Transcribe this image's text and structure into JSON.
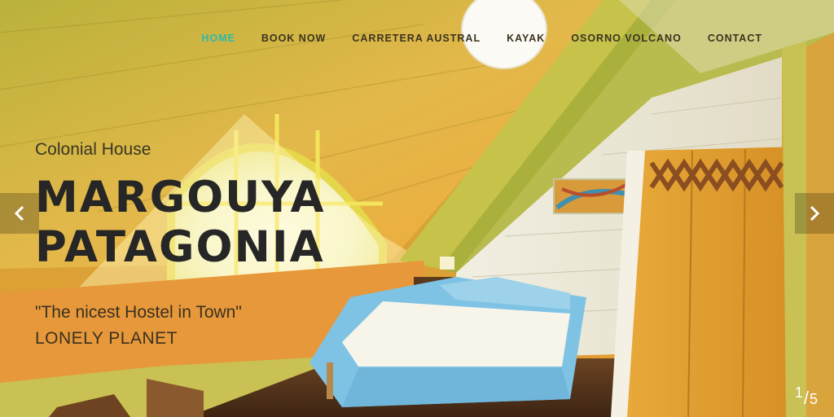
{
  "nav": {
    "items": [
      {
        "label": "HOME",
        "active": true
      },
      {
        "label": "BOOK NOW",
        "active": false
      },
      {
        "label": "CARRETERA AUSTRAL",
        "active": false
      },
      {
        "label": "KAYAK",
        "active": false
      },
      {
        "label": "OSORNO VOLCANO",
        "active": false
      },
      {
        "label": "CONTACT",
        "active": false
      }
    ],
    "active_color": "#2fb9a9"
  },
  "hero": {
    "kicker": "Colonial House",
    "title_line1": "MARGOUYA",
    "title_line2": "PATAGONIA",
    "quote": "\"The nicest Hostel in Town\"",
    "source": "LONELY PLANET"
  },
  "slider": {
    "prev_icon": "chevron-left-icon",
    "next_icon": "chevron-right-icon",
    "current": "1",
    "total": "5"
  }
}
